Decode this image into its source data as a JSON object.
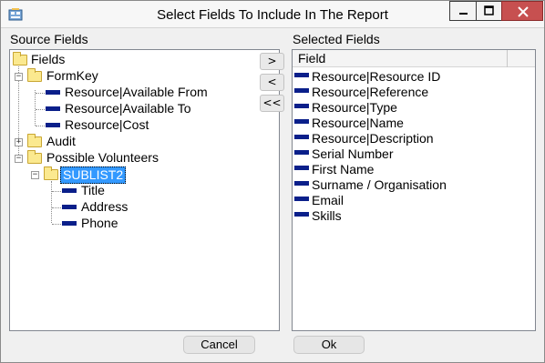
{
  "window": {
    "title": "Select Fields To Include In The Report",
    "controls": {
      "minimize": "minimize",
      "maximize": "maximize",
      "close": "close"
    }
  },
  "source": {
    "label": "Source Fields",
    "tree": {
      "root": "Fields",
      "formkey": {
        "label": "FormKey",
        "children": [
          "Resource|Available From",
          "Resource|Available To",
          "Resource|Cost"
        ]
      },
      "audit": "Audit",
      "volunteers": {
        "label": "Possible Volunteers",
        "sublist": {
          "label": "SUBLIST2",
          "children": [
            "Title",
            "Address",
            "Phone"
          ]
        }
      }
    }
  },
  "selected": {
    "label": "Selected Fields",
    "column_header": "Field",
    "items": [
      "Resource|Resource ID",
      "Resource|Reference",
      "Resource|Type",
      "Resource|Name",
      "Resource|Description",
      "Serial Number",
      "First Name",
      "Surname / Organisation",
      "Email",
      "Skills"
    ]
  },
  "transfer_buttons": {
    "add": ">",
    "remove": "<",
    "remove_all": "<<"
  },
  "footer": {
    "cancel": "Cancel",
    "ok": "Ok"
  },
  "colors": {
    "selection": "#3399ff",
    "field_icon": "#0a1f8a",
    "close_button": "#c75050"
  }
}
